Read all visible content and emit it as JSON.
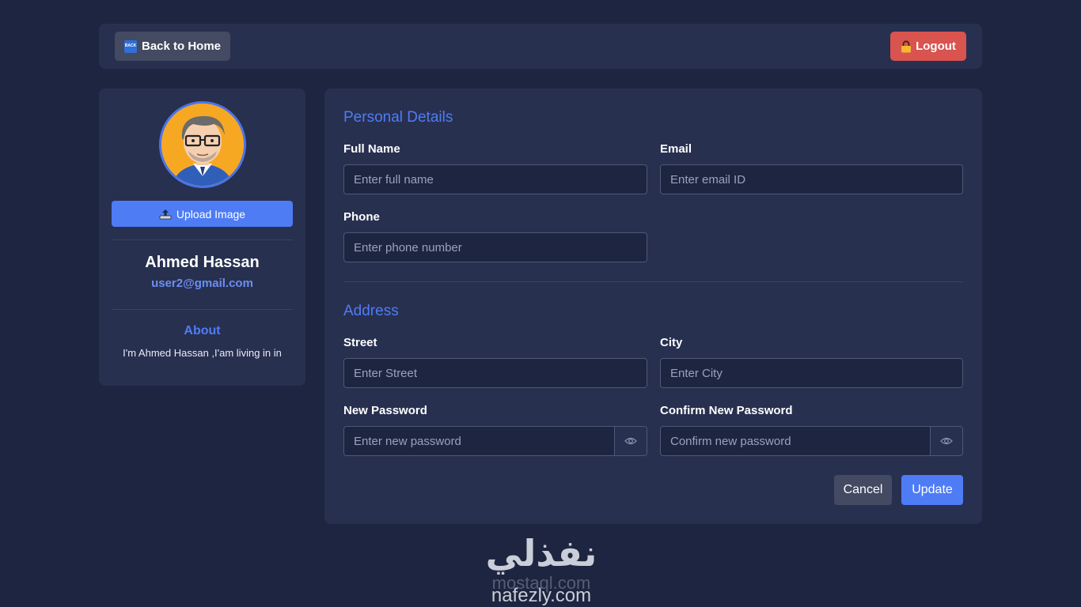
{
  "header": {
    "back_label": "Back to Home",
    "back_icon_text": "BACK",
    "logout_label": "Logout"
  },
  "profile": {
    "upload_label": "Upload Image",
    "name": "Ahmed Hassan",
    "email": "user2@gmail.com",
    "about_title": "About",
    "about_text": "I'm Ahmed Hassan ,I'am living in in"
  },
  "form": {
    "personal_title": "Personal Details",
    "full_name_label": "Full Name",
    "full_name_placeholder": "Enter full name",
    "email_label": "Email",
    "email_placeholder": "Enter email ID",
    "phone_label": "Phone",
    "phone_placeholder": "Enter phone number",
    "address_title": "Address",
    "street_label": "Street",
    "street_placeholder": "Enter Street",
    "city_label": "City",
    "city_placeholder": "Enter City",
    "new_password_label": "New Password",
    "new_password_placeholder": "Enter new password",
    "confirm_password_label": "Confirm New Password",
    "confirm_password_placeholder": "Confirm new password",
    "cancel_label": "Cancel",
    "update_label": "Update"
  },
  "watermark": {
    "arabic": "نفذلي",
    "mostaql": "mostaql.com",
    "nafezly": "nafezly.com"
  },
  "colors": {
    "background": "#1d2540",
    "card": "#283050",
    "accent": "#4e7cf5",
    "danger": "#d9534f",
    "secondary_button": "#434a62"
  },
  "icons": [
    "back-icon",
    "lock-icon",
    "upload-icon",
    "eye-icon"
  ]
}
